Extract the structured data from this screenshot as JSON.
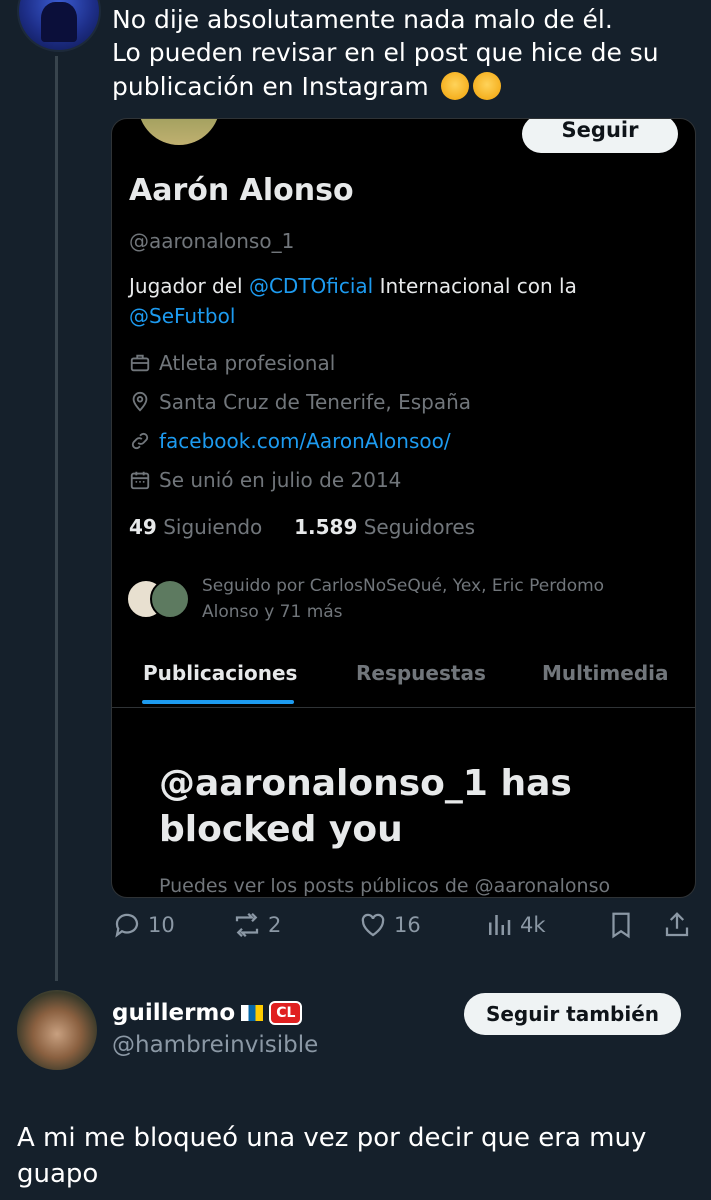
{
  "tweet1": {
    "lines": [
      "No dije absolutamente nada malo de él.",
      "Lo pueden revisar en el post que hice de su",
      "publicación en Instagram"
    ],
    "emojis": [
      "dizzy-face-emoji",
      "sad-sweat-emoji"
    ],
    "actions": {
      "replies": "10",
      "reposts": "2",
      "likes": "16",
      "views": "4k"
    }
  },
  "card": {
    "follow_label": "Seguir",
    "name": "Aarón Alonso",
    "handle": "@aaronalonso_1",
    "bio_prefix": "Jugador del ",
    "bio_link1": "@CDTOficial",
    "bio_middle": "  Internacional con la",
    "bio_link2": "@SeFutbol",
    "category": "Atleta profesional",
    "location": "Santa Cruz de Tenerife, España",
    "website": "facebook.com/AaronAlonsoo/",
    "joined": "Se unió en julio de 2014",
    "following_count": "49",
    "following_label": "Siguiendo",
    "followers_count": "1.589",
    "followers_label": "Seguidores",
    "followed_by": "Seguido por CarlosNoSeQué, Yex, Eric Perdomo Alonso y 71 más",
    "tabs": [
      "Publicaciones",
      "Respuestas",
      "Multimedia"
    ],
    "blocked_title": "@aaronalonso_1 has blocked you",
    "blocked_sub": "Puedes ver los posts públicos de @aaronalonso"
  },
  "tweet2": {
    "name": "guillermo",
    "badge": "CL",
    "handle": "@hambreinvisible",
    "follow_label": "Seguir también",
    "text": "A mi me bloqueó una vez por decir que era muy guapo"
  },
  "colors": {
    "background": "#15202b",
    "link": "#1d9bf0",
    "muted": "#71767b"
  }
}
